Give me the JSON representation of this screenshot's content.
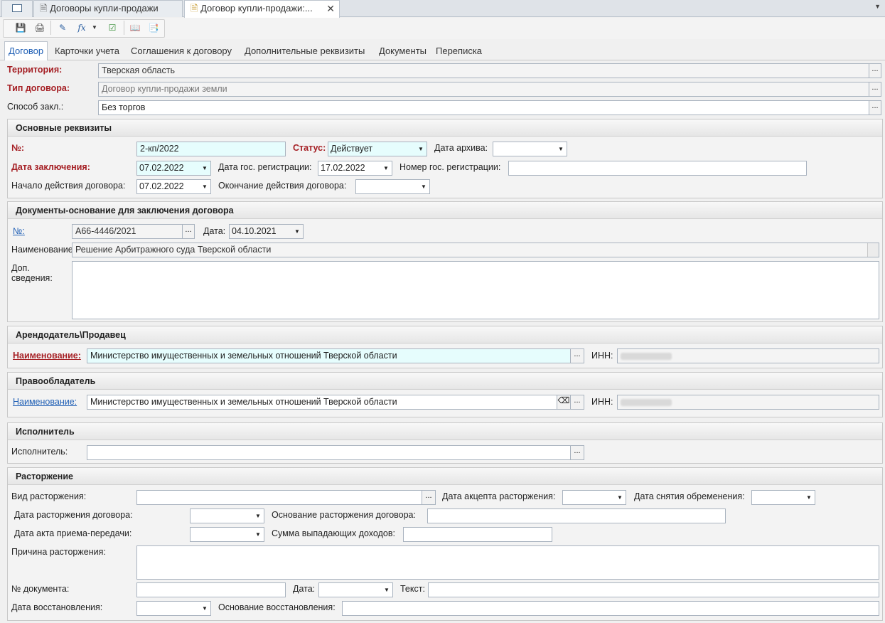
{
  "window_tabs": [
    {
      "label": ""
    },
    {
      "label": "Договоры купли-продажи"
    },
    {
      "label": "Договор купли-продажи:..."
    }
  ],
  "toolbar": {
    "icons": [
      "save-icon",
      "print-icon",
      "edit-icon",
      "formula-icon",
      "dropdown-icon",
      "check-doc-icon",
      "book-icon",
      "copy-doc-icon"
    ]
  },
  "subtabs": [
    "Договор",
    "Карточки учета",
    "Соглашения к договору",
    "Дополнительные реквизиты",
    "Документы",
    "Переписка"
  ],
  "header": {
    "territory_label": "Территория:",
    "territory_value": "Тверская область",
    "type_label": "Тип договора:",
    "type_value": "Договор купли-продажи земли",
    "method_label": "Способ закл.:",
    "method_value": "Без торгов"
  },
  "main": {
    "title": "Основные реквизиты",
    "number_label": "№:",
    "number_value": "2-кп/2022",
    "status_label": "Статус:",
    "status_value": "Действует",
    "archive_date_label": "Дата архива:",
    "archive_date_value": "",
    "conclusion_date_label": "Дата заключения:",
    "conclusion_date_value": "07.02.2022",
    "reg_date_label": "Дата гос. регистрации:",
    "reg_date_value": "17.02.2022",
    "reg_number_label": "Номер гос. регистрации:",
    "reg_number_value": "",
    "start_label": "Начало действия договора:",
    "start_value": "07.02.2022",
    "end_label": "Окончание действия договора:",
    "end_value": ""
  },
  "basis": {
    "title": "Документы-основание для заключения договора",
    "number_label": "№:",
    "number_value": "А66-4446/2021",
    "date_label": "Дата:",
    "date_value": "04.10.2021",
    "name_label": "Наименование:",
    "name_value": "Решение Арбитражного суда Тверской области",
    "extra_label_1": "Доп.",
    "extra_label_2": "сведения:",
    "extra_value": ""
  },
  "seller": {
    "title": "Арендодатель\\Продавец",
    "name_label": "Наименование:",
    "name_value": "Министерство имущественных и земельных отношений Тверской области",
    "inn_label": "ИНН:"
  },
  "holder": {
    "title": "Правообладатель",
    "name_label": "Наименование:",
    "name_value": "Министерство имущественных и земельных отношений Тверской области",
    "inn_label": "ИНН:"
  },
  "executor": {
    "title": "Исполнитель",
    "label": "Исполнитель:",
    "value": ""
  },
  "termination": {
    "title": "Расторжение",
    "kind_label": "Вид расторжения:",
    "accept_date_label": "Дата акцепта расторжения:",
    "encumbrance_date_label": "Дата снятия обременения:",
    "term_date_label": "Дата расторжения договора:",
    "basis_label": "Основание расторжения договора:",
    "act_date_label": "Дата акта приема-передачи:",
    "lost_income_label": "Сумма выпадающих доходов:",
    "reason_label": "Причина расторжения:",
    "doc_number_label": "№ документа:",
    "doc_date_label": "Дата:",
    "text_label": "Текст:",
    "restore_date_label": "Дата восстановления:",
    "restore_basis_label": "Основание восстановления:"
  }
}
